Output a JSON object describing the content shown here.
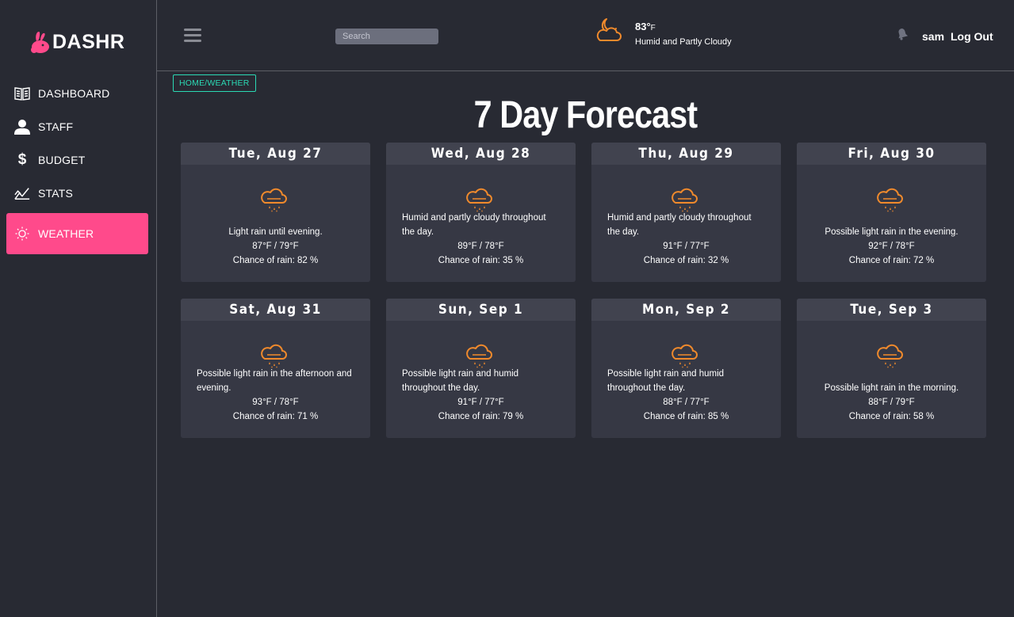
{
  "app": {
    "name": "DASHR"
  },
  "sidebar": {
    "items": [
      {
        "label": "DASHBOARD",
        "icon": "book-icon",
        "active": false
      },
      {
        "label": "STAFF",
        "icon": "person-icon",
        "active": false
      },
      {
        "label": "BUDGET",
        "icon": "dollar-icon",
        "active": false
      },
      {
        "label": "STATS",
        "icon": "stats-icon",
        "active": false
      },
      {
        "label": "WEATHER",
        "icon": "sun-icon",
        "active": true
      }
    ]
  },
  "header": {
    "search_placeholder": "Search",
    "current_temp": "83°",
    "current_unit": "F",
    "current_desc": "Humid and Partly Cloudy",
    "username": "sam",
    "logout_label": "Log Out"
  },
  "breadcrumb": "HOME/WEATHER",
  "page_title": "7 Day Forecast",
  "forecast": [
    {
      "day": "Tue, Aug 27",
      "desc": "Light rain until evening.",
      "temps": "87°F / 79°F",
      "rain": "Chance of rain: 82 %"
    },
    {
      "day": "Wed, Aug 28",
      "desc": "Humid and partly cloudy throughout the day.",
      "temps": "89°F / 78°F",
      "rain": "Chance of rain: 35 %"
    },
    {
      "day": "Thu, Aug 29",
      "desc": "Humid and partly cloudy throughout the day.",
      "temps": "91°F / 77°F",
      "rain": "Chance of rain: 32 %"
    },
    {
      "day": "Fri, Aug 30",
      "desc": "Possible light rain in the evening.",
      "temps": "92°F / 78°F",
      "rain": "Chance of rain: 72 %"
    },
    {
      "day": "Sat, Aug 31",
      "desc": "Possible light rain in the afternoon and evening.",
      "temps": "93°F / 78°F",
      "rain": "Chance of rain: 71 %"
    },
    {
      "day": "Sun, Sep 1",
      "desc": "Possible light rain and humid throughout the day.",
      "temps": "91°F / 77°F",
      "rain": "Chance of rain: 79 %"
    },
    {
      "day": "Mon, Sep 2",
      "desc": "Possible light rain and humid throughout the day.",
      "temps": "88°F / 77°F",
      "rain": "Chance of rain: 85 %"
    },
    {
      "day": "Tue, Sep 3",
      "desc": "Possible light rain in the morning.",
      "temps": "88°F / 79°F",
      "rain": "Chance of rain: 58 %"
    }
  ],
  "colors": {
    "accent": "#ff4a8b",
    "breadcrumb": "#2bd9b4",
    "weather_icon": "#f08a2c",
    "background": "#282a33",
    "card": "#363844",
    "card_header": "#41434f"
  }
}
